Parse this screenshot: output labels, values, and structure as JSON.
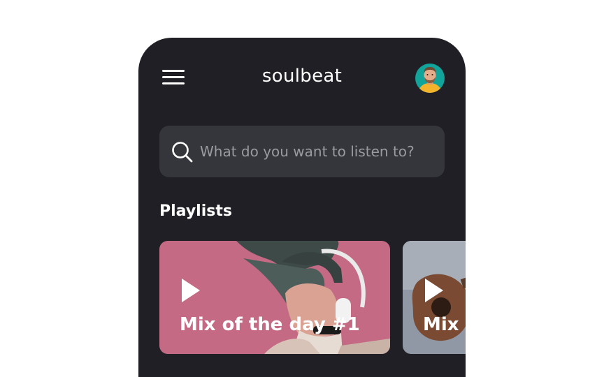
{
  "header": {
    "app_name": "soulbeat",
    "menu_icon": "hamburger-menu-icon",
    "avatar_icon": "user-avatar"
  },
  "search": {
    "placeholder": "What do you want to listen to?",
    "value": "",
    "icon": "search-icon"
  },
  "playlists": {
    "title": "Playlists",
    "items": [
      {
        "title": "Mix of the day #1",
        "icon": "play-icon"
      },
      {
        "title": "Mix",
        "icon": "play-icon"
      }
    ]
  },
  "colors": {
    "background": "#1f1f25",
    "search_bg": "#35353c",
    "card1_accent": "#c76a86",
    "card2_accent": "#8d96a2",
    "avatar_bg": "#12a39a"
  }
}
